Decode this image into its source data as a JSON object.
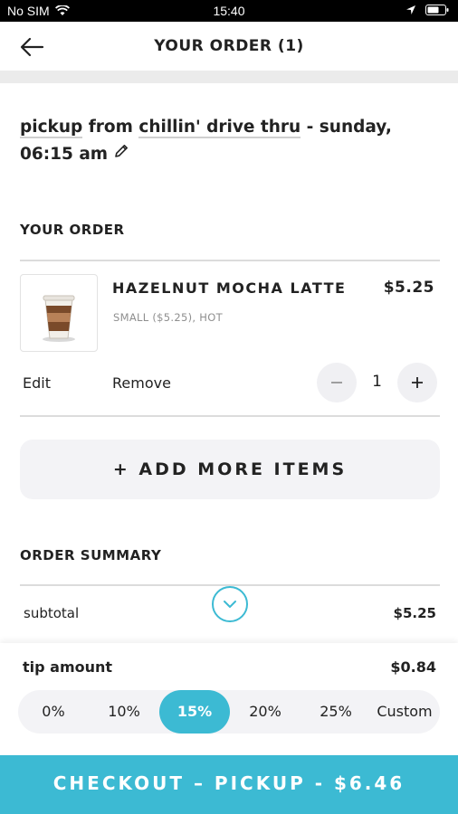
{
  "status_bar": {
    "carrier": "No SIM",
    "time": "15:40"
  },
  "header": {
    "title": "YOUR ORDER (1)"
  },
  "pickup": {
    "prefix": "pickup",
    "from_word": "from",
    "location": "chillin' drive thru",
    "schedule": "- sunday, 06:15 am"
  },
  "order": {
    "section_title": "YOUR ORDER",
    "item": {
      "name": "HAZELNUT MOCHA LATTE",
      "price": "$5.25",
      "options": "SMALL ($5.25), HOT",
      "quantity": "1",
      "edit_label": "Edit",
      "remove_label": "Remove"
    },
    "add_more_label": "+ ADD MORE ITEMS"
  },
  "summary": {
    "section_title": "ORDER SUMMARY",
    "subtotal_label": "subtotal",
    "subtotal_value": "$5.25",
    "tip_label": "tip amount",
    "tip_value": "$0.84",
    "tip_options": [
      "0%",
      "10%",
      "15%",
      "20%",
      "25%",
      "Custom"
    ],
    "tip_selected": "15%"
  },
  "checkout": {
    "label": "CHECKOUT – PICKUP - $6.46"
  },
  "colors": {
    "accent": "#3cbad3",
    "panel": "#f3f3f6",
    "divider": "#dcdcdc"
  }
}
